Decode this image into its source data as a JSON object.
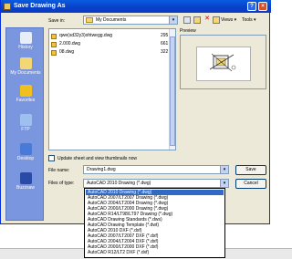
{
  "window": {
    "title": "Save Drawing As",
    "help_glyph": "?",
    "close_glyph": "×"
  },
  "toolbar": {
    "save_in_label": "Save in:",
    "save_in_value": "My Documents",
    "dropdown_glyph": "▾",
    "delete_glyph": "✕",
    "views_label": "Views ▾",
    "tools_label": "Tools ▾"
  },
  "places": [
    {
      "label": "History",
      "icon": "history-icon",
      "color": "#e8eef8"
    },
    {
      "label": "My Documents",
      "icon": "my-documents-icon",
      "color": "#f3d774"
    },
    {
      "label": "Favorites",
      "icon": "favorites-icon",
      "color": "#f0c020"
    },
    {
      "label": "FTP",
      "icon": "ftp-icon",
      "color": "#9ec0ee"
    },
    {
      "label": "Desktop",
      "icon": "desktop-icon",
      "color": "#4a7ad8"
    },
    {
      "label": "Buzzsaw",
      "icon": "buzzsaw-icon",
      "color": "#2a4aa8"
    }
  ],
  "files": [
    {
      "name": "qwe(sd32y3)ohtwegg.dwg",
      "size": "295 k"
    },
    {
      "name": "2.000.dwg",
      "size": "661 k"
    },
    {
      "name": "08.dwg",
      "size": "322 k"
    }
  ],
  "preview_label": "Preview",
  "thumbnail_checkbox_label": "Update sheet and view thumbnails now",
  "filename": {
    "label": "File name:",
    "value": "Drawing1.dwg"
  },
  "filetype": {
    "label": "Files of type:",
    "value": "AutoCAD 2010 Drawing (*.dwg)"
  },
  "buttons": {
    "save": "Save",
    "cancel": "Cancel"
  },
  "filetype_options": [
    {
      "label": "AutoCAD 2010 Drawing (*.dwg)",
      "selected": true
    },
    {
      "label": "AutoCAD 2007/LT2007 Drawing (*.dwg)",
      "selected": false
    },
    {
      "label": "AutoCAD 2004/LT2004 Drawing (*.dwg)",
      "selected": false
    },
    {
      "label": "AutoCAD 2000/LT2000 Drawing (*.dwg)",
      "selected": false
    },
    {
      "label": "AutoCAD R14/LT98/LT97 Drawing (*.dwg)",
      "selected": false
    },
    {
      "label": "AutoCAD Drawing Standards (*.dws)",
      "selected": false
    },
    {
      "label": "AutoCAD Drawing Template (*.dwt)",
      "selected": false
    },
    {
      "label": "AutoCAD 2010 DXF (*.dxf)",
      "selected": false
    },
    {
      "label": "AutoCAD 2007/LT2007 DXF (*.dxf)",
      "selected": false
    },
    {
      "label": "AutoCAD 2004/LT2004 DXF (*.dxf)",
      "selected": false
    },
    {
      "label": "AutoCAD 2000/LT2000 DXF (*.dxf)",
      "selected": false
    },
    {
      "label": "AutoCAD R12/LT2 DXF (*.dxf)",
      "selected": false
    }
  ]
}
